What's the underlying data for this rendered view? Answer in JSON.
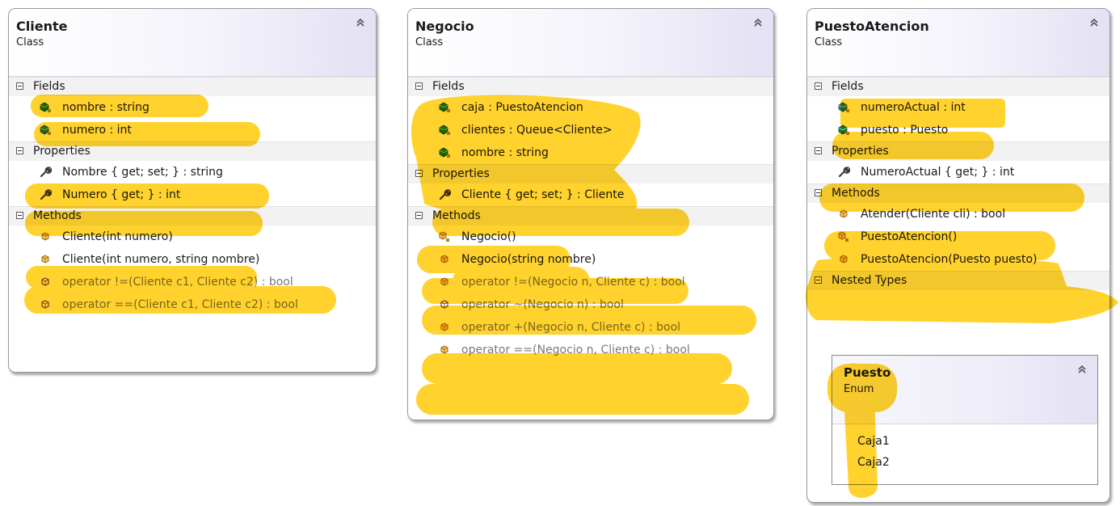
{
  "classes": {
    "cliente": {
      "name": "Cliente",
      "kind": "Class",
      "sections": {
        "fields": {
          "title": "Fields",
          "items": [
            "nombre : string",
            "numero : int"
          ]
        },
        "properties": {
          "title": "Properties",
          "items": [
            "Nombre { get; set; } : string",
            "Numero { get; } : int"
          ]
        },
        "methods": {
          "title": "Methods",
          "items": [
            "Cliente(int numero)",
            "Cliente(int numero, string nombre)",
            "operator !=(Cliente c1, Cliente c2) : bool",
            "operator ==(Cliente c1, Cliente c2) : bool"
          ]
        }
      }
    },
    "negocio": {
      "name": "Negocio",
      "kind": "Class",
      "sections": {
        "fields": {
          "title": "Fields",
          "items": [
            "caja : PuestoAtencion",
            "clientes : Queue<Cliente>",
            "nombre : string"
          ]
        },
        "properties": {
          "title": "Properties",
          "items": [
            "Cliente { get; set; } : Cliente"
          ]
        },
        "methods": {
          "title": "Methods",
          "items": [
            "Negocio()",
            "Negocio(string nombre)",
            "operator !=(Negocio n, Cliente c) : bool",
            "operator ~(Negocio n) : bool",
            "operator +(Negocio n, Cliente c) : bool",
            "operator ==(Negocio n, Cliente c) : bool"
          ]
        }
      }
    },
    "puesto_atencion": {
      "name": "PuestoAtencion",
      "kind": "Class",
      "sections": {
        "fields": {
          "title": "Fields",
          "items": [
            "numeroActual : int",
            "puesto : Puesto"
          ]
        },
        "properties": {
          "title": "Properties",
          "items": [
            "NumeroActual { get; } : int"
          ]
        },
        "methods": {
          "title": "Methods",
          "items": [
            "Atender(Cliente cli) : bool",
            "PuestoAtencion()",
            "PuestoAtencion(Puesto puesto)"
          ]
        },
        "nested": {
          "title": "Nested Types"
        }
      },
      "nested_enum": {
        "name": "Puesto",
        "kind": "Enum",
        "values": [
          "Caja1",
          "Caja2"
        ]
      }
    }
  },
  "icons": {
    "field": "field-icon",
    "property": "wrench-icon",
    "method": "method-icon",
    "private_badge": "lock-badge-icon",
    "collapse": "double-chevron-up-icon"
  },
  "colors": {
    "highlight": "#ffc800",
    "field_icon": "#1c7a2c",
    "method_icon": "#e0a020",
    "operator_icon": "#7a3fb0",
    "property_icon": "#4a4a4a"
  }
}
